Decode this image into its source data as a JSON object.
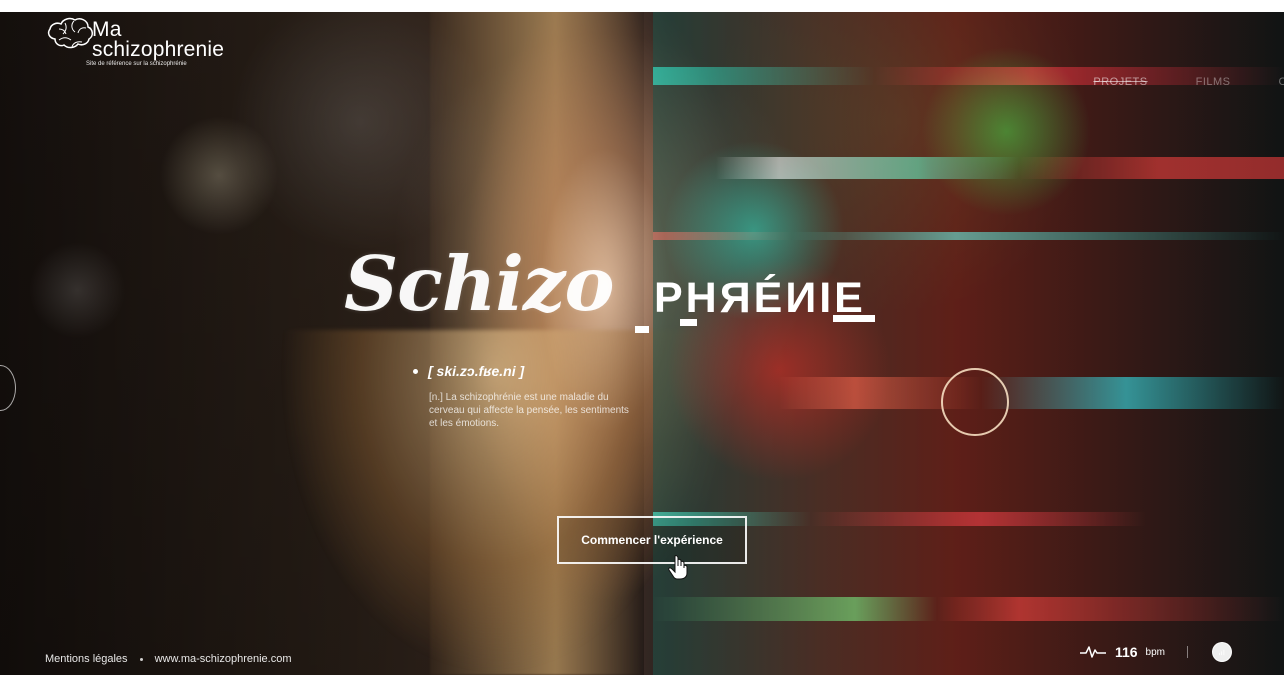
{
  "brand": {
    "line1": "Ma",
    "line2": "schizophrenie",
    "tagline": "Site de référence sur la schizophrénie",
    "icon": "brain-icon"
  },
  "nav": {
    "items": [
      "PROJETS",
      "FILMS",
      "CO"
    ]
  },
  "hero": {
    "title_left": "Schizo",
    "title_right": "PHЯÉИIE",
    "phonetic": "[ ski.zɔ.fʁe.ni ]",
    "definition": "[n.] La schizophrénie est une maladie du cerveau qui affecte la pensée, les sentiments et les émotions.",
    "cta": "Commencer l'expérience"
  },
  "footer": {
    "legal": "Mentions légales",
    "site": "www.ma-schizophrenie.com"
  },
  "heart": {
    "value": "116",
    "unit": "bpm",
    "icon": "pulse-icon"
  },
  "controls": {
    "sound_icon": "sound-icon"
  },
  "colors": {
    "white": "#ffffff",
    "glitch_red": "#ff2b3b",
    "glitch_cyan": "#10fff0",
    "glitch_green": "#43ff7a",
    "warm_skin": "#ffd6b5"
  }
}
